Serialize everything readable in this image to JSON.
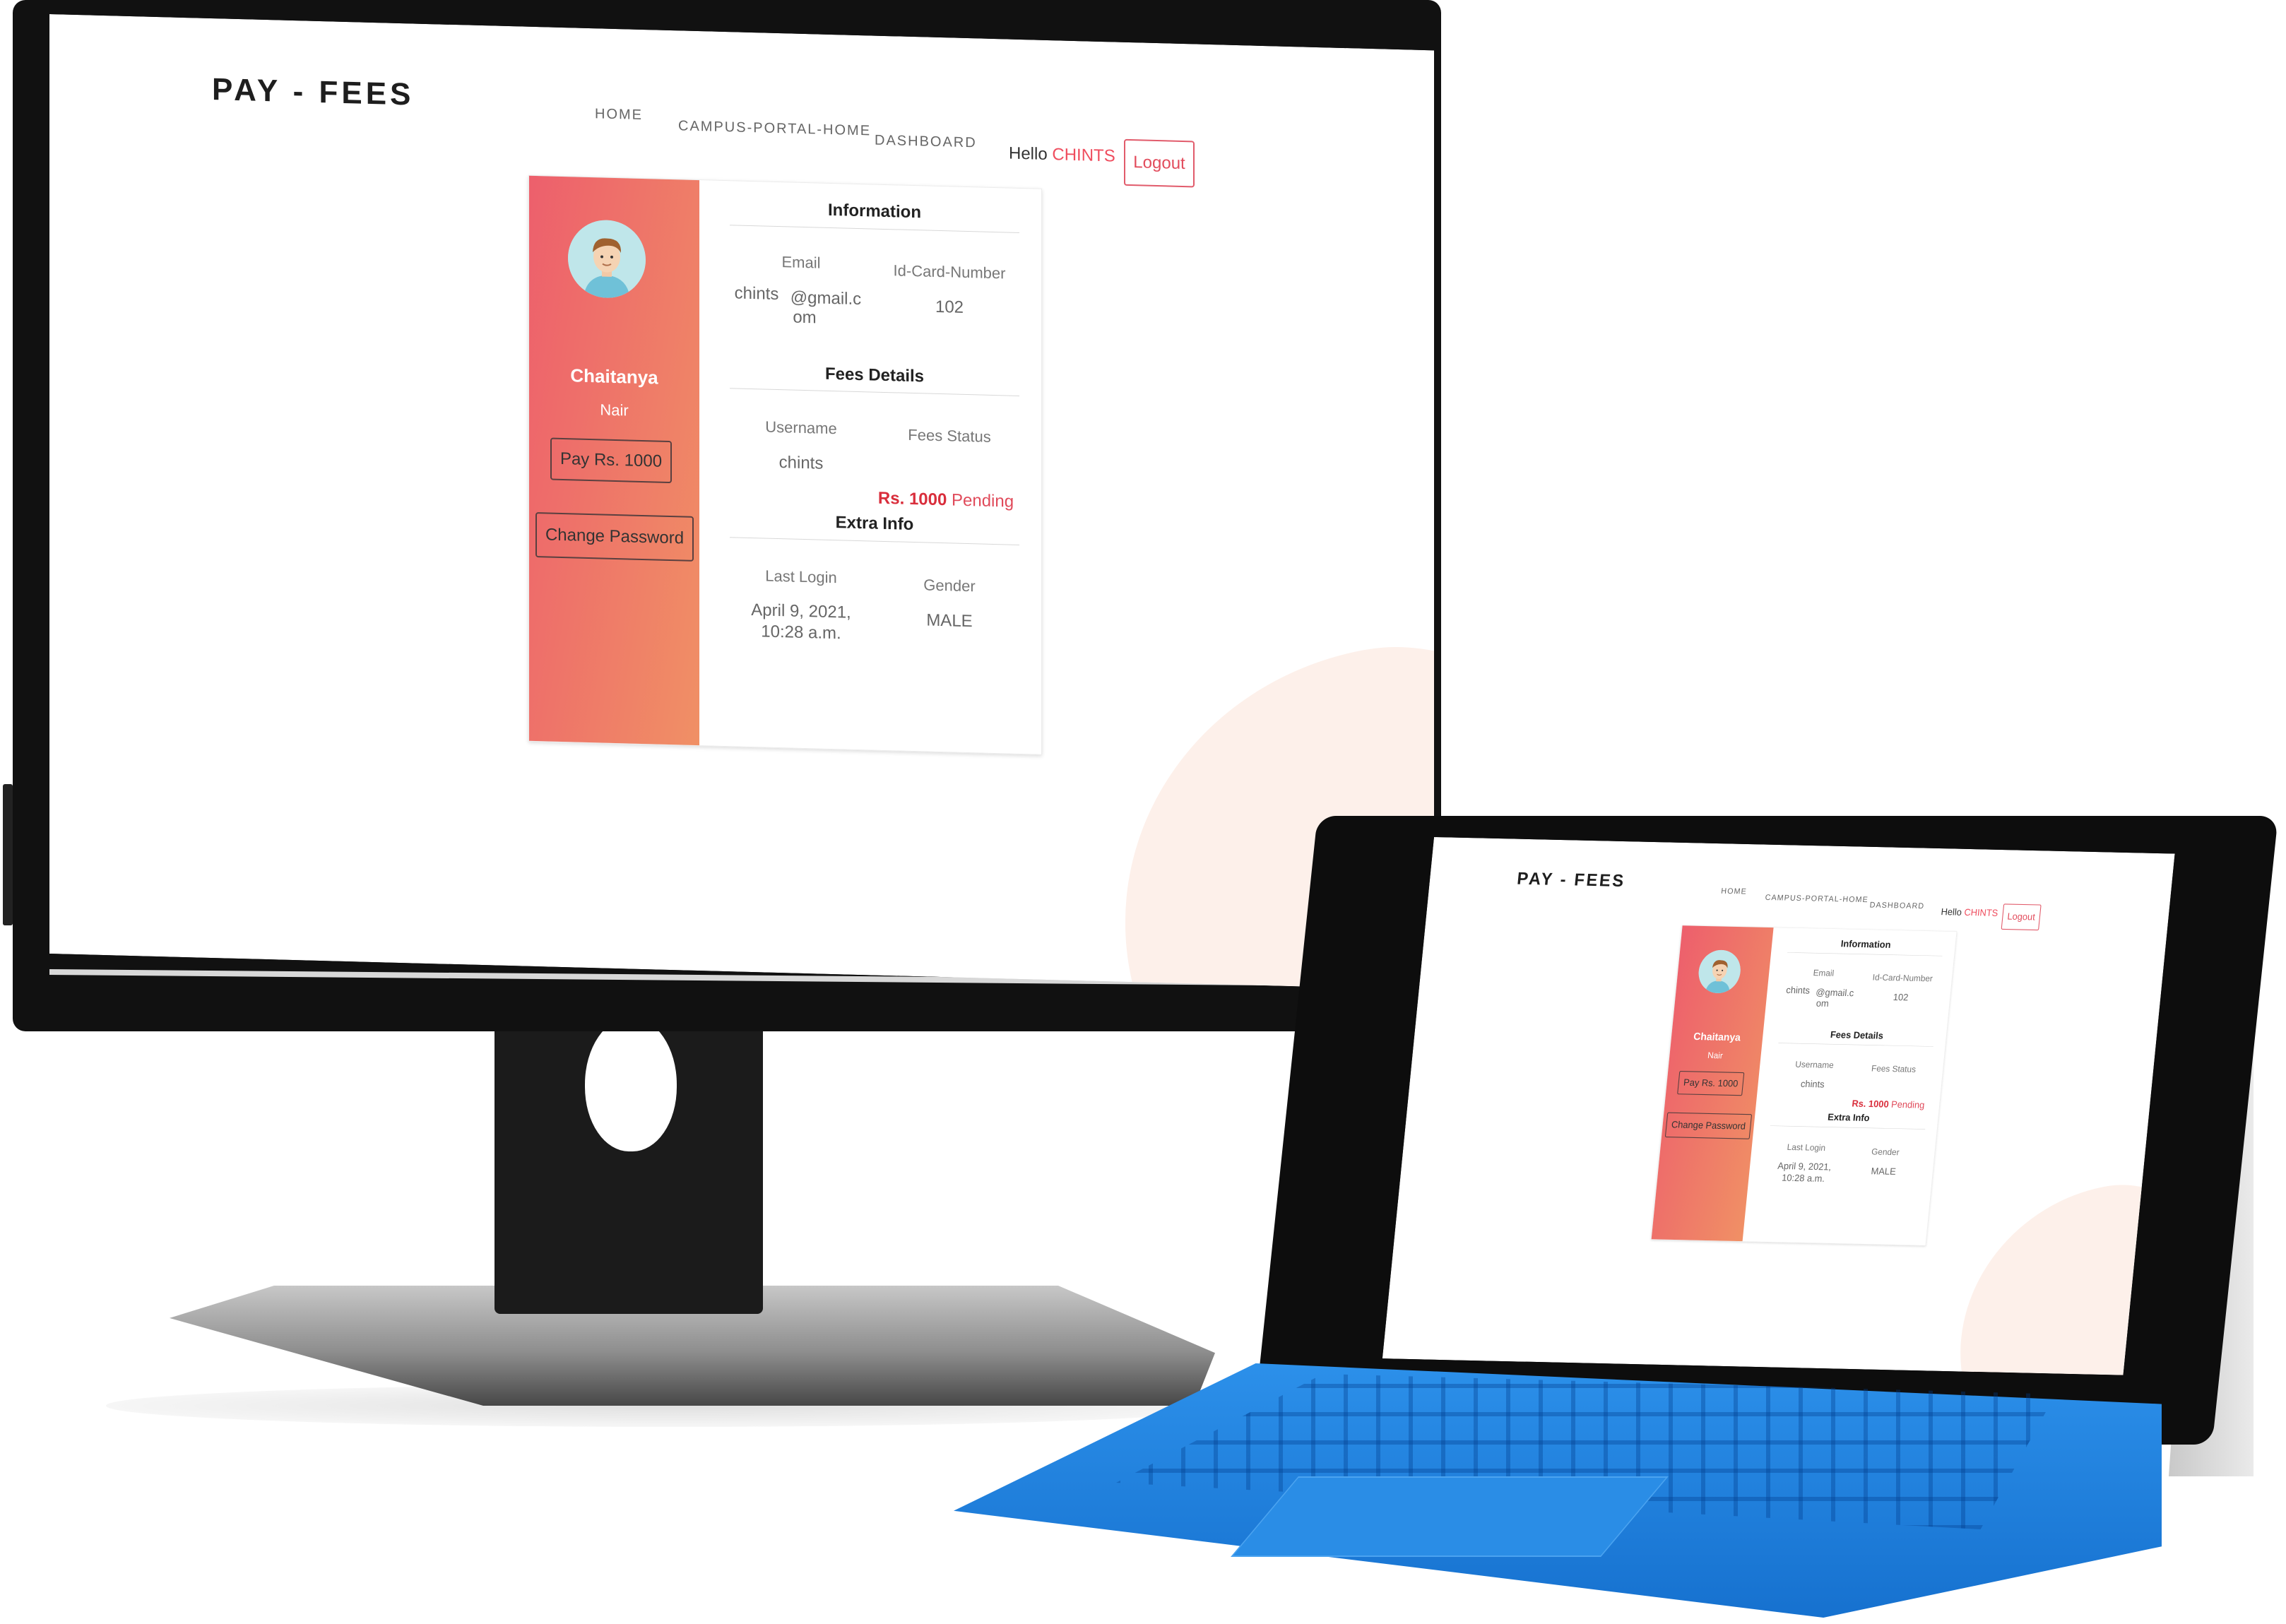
{
  "app": {
    "brand": "PAY - FEES",
    "nav": {
      "home": "HOME",
      "campus_portal_home": "CAMPUS-PORTAL-HOME",
      "dashboard": "DASHBOARD",
      "hello_prefix": "Hello",
      "username": "CHINTS",
      "logout": "Logout"
    },
    "profile": {
      "first_name": "Chaitanya",
      "last_name": "Nair",
      "pay_button": "Pay Rs. 1000",
      "change_password_button": "Change Password"
    },
    "information": {
      "title": "Information",
      "email_label": "Email",
      "email_value_1": "chints",
      "email_value_2": "@gmail.c",
      "email_value_3": "om",
      "id_card_label": "Id-Card-Number",
      "id_card_value": "102"
    },
    "fees": {
      "title": "Fees Details",
      "username_label": "Username",
      "username_value": "chints",
      "status_label": "Fees Status",
      "status_amount": "Rs. 1000",
      "status_text": "Pending"
    },
    "extra": {
      "title": "Extra Info",
      "last_login_label": "Last Login",
      "last_login_line1": "April 9, 2021,",
      "last_login_line2": "10:28 a.m.",
      "gender_label": "Gender",
      "gender_value": "MALE"
    }
  },
  "colors": {
    "accent": "#ef4d5e",
    "gradient_start": "#ed5f6c",
    "gradient_end": "#f09065",
    "pending_amount": "#d92e3c",
    "keyboard": "#1a7fe0"
  },
  "icons": {
    "avatar": "user-avatar-illustration"
  }
}
